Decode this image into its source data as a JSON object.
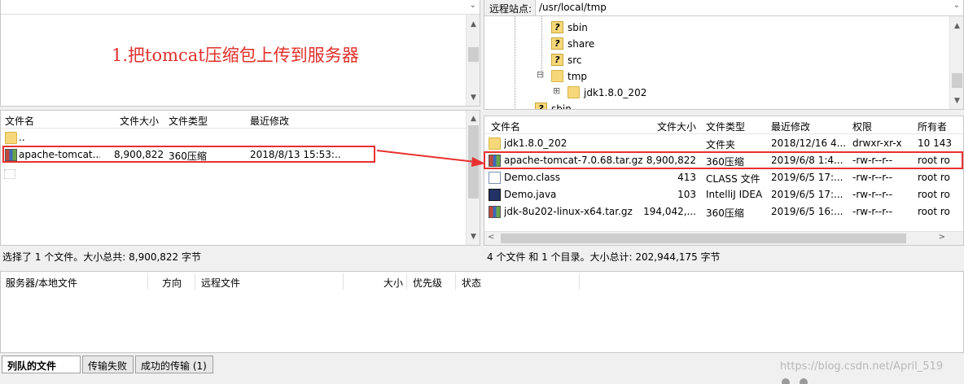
{
  "annotation": "1.把tomcat压缩包上传到服务器",
  "remote_site": {
    "label": "远程站点:",
    "path": "/usr/local/tmp"
  },
  "remote_tree": [
    {
      "name": "sbin",
      "icon": "unknown-folder-icon"
    },
    {
      "name": "share",
      "icon": "unknown-folder-icon"
    },
    {
      "name": "src",
      "icon": "unknown-folder-icon"
    },
    {
      "name": "tmp",
      "icon": "folder-icon",
      "toggle": "⊟"
    },
    {
      "name": "jdk1.8.0_202",
      "icon": "folder-icon",
      "toggle": "⊞"
    },
    {
      "name": "sbin",
      "icon": "unknown-folder-icon"
    }
  ],
  "local_list": {
    "columns": [
      "文件名",
      "文件大小",
      "文件类型",
      "最近修改"
    ],
    "rows": [
      {
        "name": "..",
        "size": "",
        "type": "",
        "modified": "",
        "icon": "folder-icon"
      },
      {
        "name": "apache-tomcat...",
        "size": "8,900,822",
        "type": "360压缩",
        "modified": "2018/8/13 15:53:...",
        "icon": "archive-icon"
      }
    ],
    "status": "选择了 1 个文件。大小总共: 8,900,822 字节"
  },
  "remote_list": {
    "columns": [
      "文件名",
      "文件大小",
      "文件类型",
      "最近修改",
      "权限",
      "所有者"
    ],
    "rows": [
      {
        "name": "jdk1.8.0_202",
        "size": "",
        "type": "文件夹",
        "modified": "2018/12/16 4...",
        "perm": "drwxr-xr-x",
        "owner": "10 143",
        "icon": "folder-icon"
      },
      {
        "name": "apache-tomcat-7.0.68.tar.gz",
        "size": "8,900,822",
        "type": "360压缩",
        "modified": "2019/6/8 1:4...",
        "perm": "-rw-r--r--",
        "owner": "root ro",
        "icon": "archive-icon"
      },
      {
        "name": "Demo.class",
        "size": "413",
        "type": "CLASS 文件",
        "modified": "2019/6/5 17:...",
        "perm": "-rw-r--r--",
        "owner": "root ro",
        "icon": "class-file-icon"
      },
      {
        "name": "Demo.java",
        "size": "103",
        "type": "IntelliJ IDEA",
        "modified": "2019/6/5 17:...",
        "perm": "-rw-r--r--",
        "owner": "root ro",
        "icon": "java-file-icon"
      },
      {
        "name": "jdk-8u202-linux-x64.tar.gz",
        "size": "194,042,...",
        "type": "360压缩",
        "modified": "2019/6/5 16:...",
        "perm": "-rw-r--r--",
        "owner": "root ro",
        "icon": "archive-icon"
      }
    ],
    "status": "4 个文件 和 1 个目录。大小总计: 202,944,175 字节"
  },
  "queue": {
    "columns": [
      "服务器/本地文件",
      "方向",
      "远程文件",
      "大小",
      "优先级",
      "状态"
    ]
  },
  "tabs": [
    "列队的文件",
    "传输失败",
    "成功的传输 (1)"
  ],
  "watermark": "https://blog.csdn.net/April_519",
  "colors": {
    "highlight": "#e8312f",
    "annotation_text": "#e0302a"
  }
}
